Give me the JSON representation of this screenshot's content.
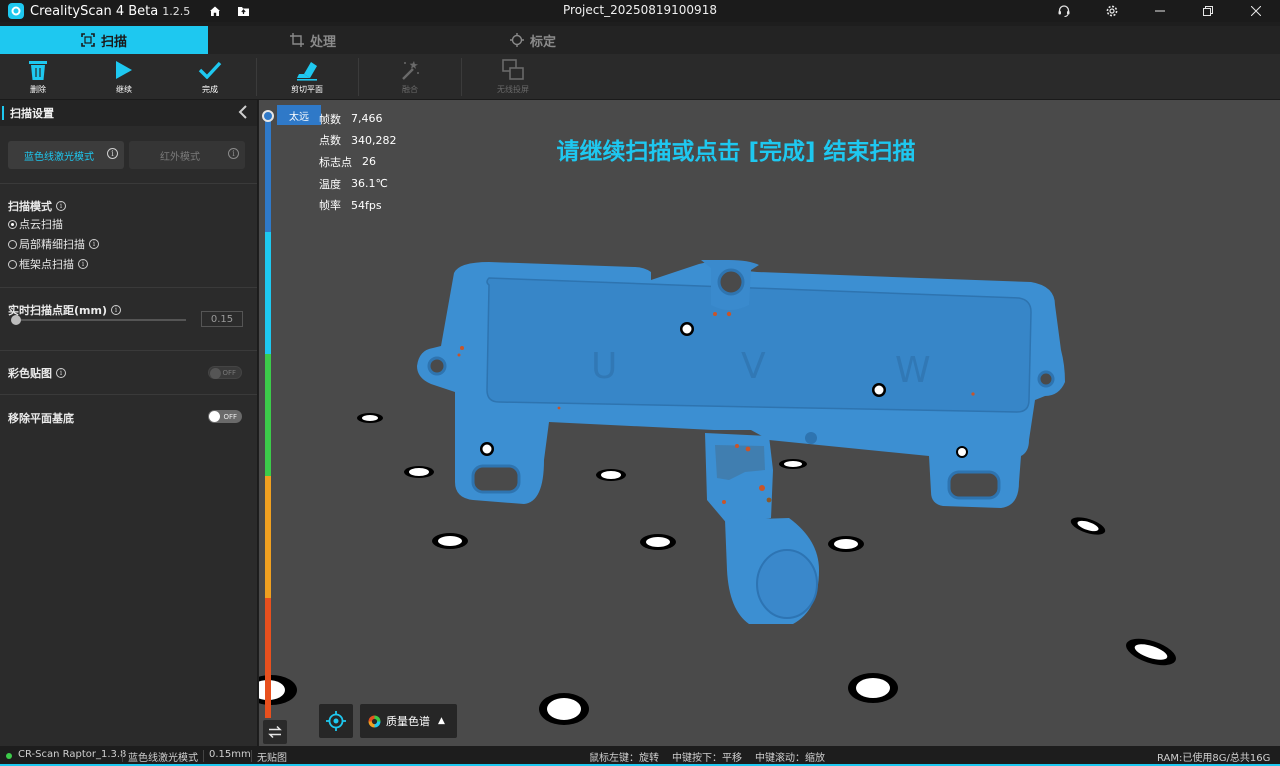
{
  "titlebar": {
    "app_name": "CrealityScan 4 Beta",
    "version": "1.2.5",
    "project": "Project_20250819100918"
  },
  "tabs": [
    {
      "label": "扫描",
      "active": true
    },
    {
      "label": "处理",
      "active": false
    },
    {
      "label": "标定",
      "active": false
    }
  ],
  "toolbar": {
    "delete": "删除",
    "continue": "继续",
    "finish": "完成",
    "cut_plane": "剪切平面",
    "merge": "融合",
    "wireless": "无线投屏"
  },
  "panel": {
    "title": "扫描设置",
    "mode_blue": "蓝色线激光模式",
    "mode_ir": "红外模式",
    "scan_mode_title": "扫描模式",
    "scan_modes": [
      "点云扫描",
      "局部精细扫描",
      "框架点扫描"
    ],
    "point_spacing_title": "实时扫描点距(mm)",
    "point_spacing_value": "0.15",
    "color_texture_title": "彩色贴图",
    "color_texture_toggle": "OFF",
    "remove_plane_title": "移除平面基底",
    "remove_plane_toggle": "OFF"
  },
  "viewport": {
    "distance_label": "太远",
    "stats": [
      {
        "k": "帧数",
        "v": "7,466"
      },
      {
        "k": "点数",
        "v": "340,282"
      },
      {
        "k": "标志点",
        "v": "26"
      },
      {
        "k": "温度",
        "v": "36.1℃"
      },
      {
        "k": "帧率",
        "v": "54fps"
      }
    ],
    "hint": "请继续扫描或点击 [完成] 结束扫描",
    "quality_label": "质量色谱"
  },
  "statusbar": {
    "device": "CR-Scan Raptor_1.3.8",
    "mode": "蓝色线激光模式",
    "spacing": "0.15mm",
    "texture": "无贴图",
    "left_mouse": "鼠标左键：旋转",
    "middle_press": "中键按下：平移",
    "middle_scroll": "中键滚动：缩放",
    "ram": "RAM:已使用8G/总共16G"
  },
  "colors": {
    "accent": "#1ec8f0",
    "scan_blue": "#3c8fd2",
    "viewport_bg": "#4a4a4a",
    "distance_bar": [
      "#2f79c8",
      "#1ec8f0",
      "#3ccb4a",
      "#f0a020",
      "#e8501e"
    ]
  }
}
